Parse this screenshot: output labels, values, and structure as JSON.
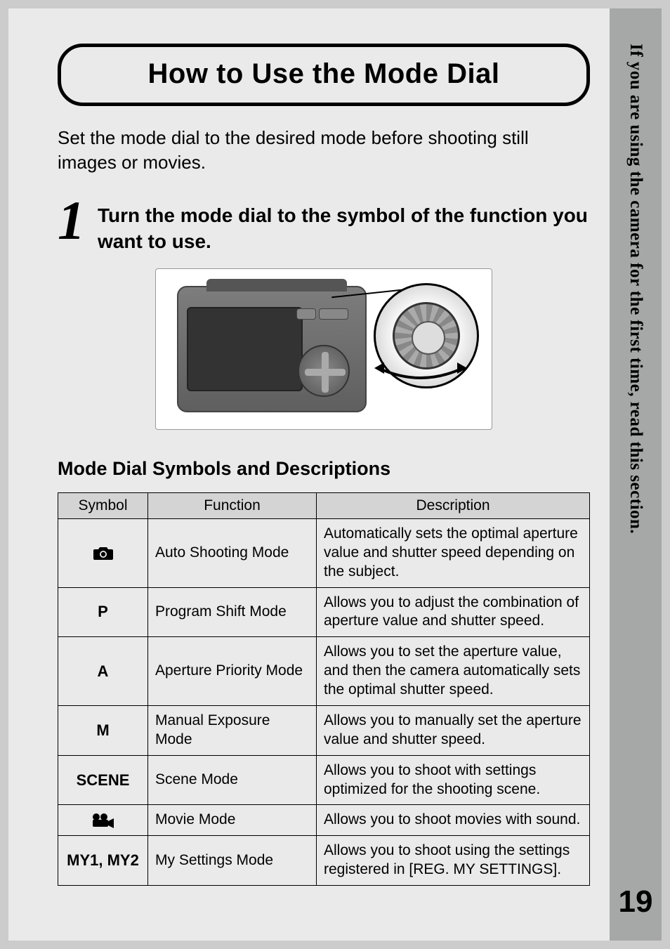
{
  "side": {
    "vertical_text": "If you are using the camera for the first time, read this section.",
    "page_number": "19"
  },
  "title": "How to Use the Mode Dial",
  "intro": "Set the mode dial to the desired mode before shooting still images or movies.",
  "step": {
    "number": "1",
    "text": "Turn the mode dial to the symbol of the function you want to use."
  },
  "subheading": "Mode Dial Symbols and Descriptions",
  "table": {
    "headers": {
      "symbol": "Symbol",
      "function": "Function",
      "description": "Description"
    },
    "rows": [
      {
        "symbol_kind": "camera-icon",
        "symbol_text": "",
        "function": "Auto Shooting Mode",
        "description": "Automatically sets the optimal aperture value and shutter speed depending on the subject."
      },
      {
        "symbol_kind": "text",
        "symbol_text": "P",
        "function": "Program Shift Mode",
        "description": "Allows you to adjust the combination of aperture value and shutter speed."
      },
      {
        "symbol_kind": "text",
        "symbol_text": "A",
        "function": "Aperture Priority Mode",
        "description": "Allows you to set the aperture value, and then the camera automatically sets the optimal shutter speed."
      },
      {
        "symbol_kind": "text",
        "symbol_text": "M",
        "function": "Manual Exposure Mode",
        "description": "Allows you to manually set the aperture value and shutter speed."
      },
      {
        "symbol_kind": "text",
        "symbol_text": "SCENE",
        "function": "Scene Mode",
        "description": "Allows you to shoot with settings optimized for the shooting scene."
      },
      {
        "symbol_kind": "movie-icon",
        "symbol_text": "",
        "function": "Movie Mode",
        "description": "Allows you to shoot movies with sound."
      },
      {
        "symbol_kind": "text",
        "symbol_text": "MY1, MY2",
        "function": "My Settings Mode",
        "description": "Allows you to shoot using the settings registered in [REG. MY SETTINGS]."
      }
    ]
  }
}
